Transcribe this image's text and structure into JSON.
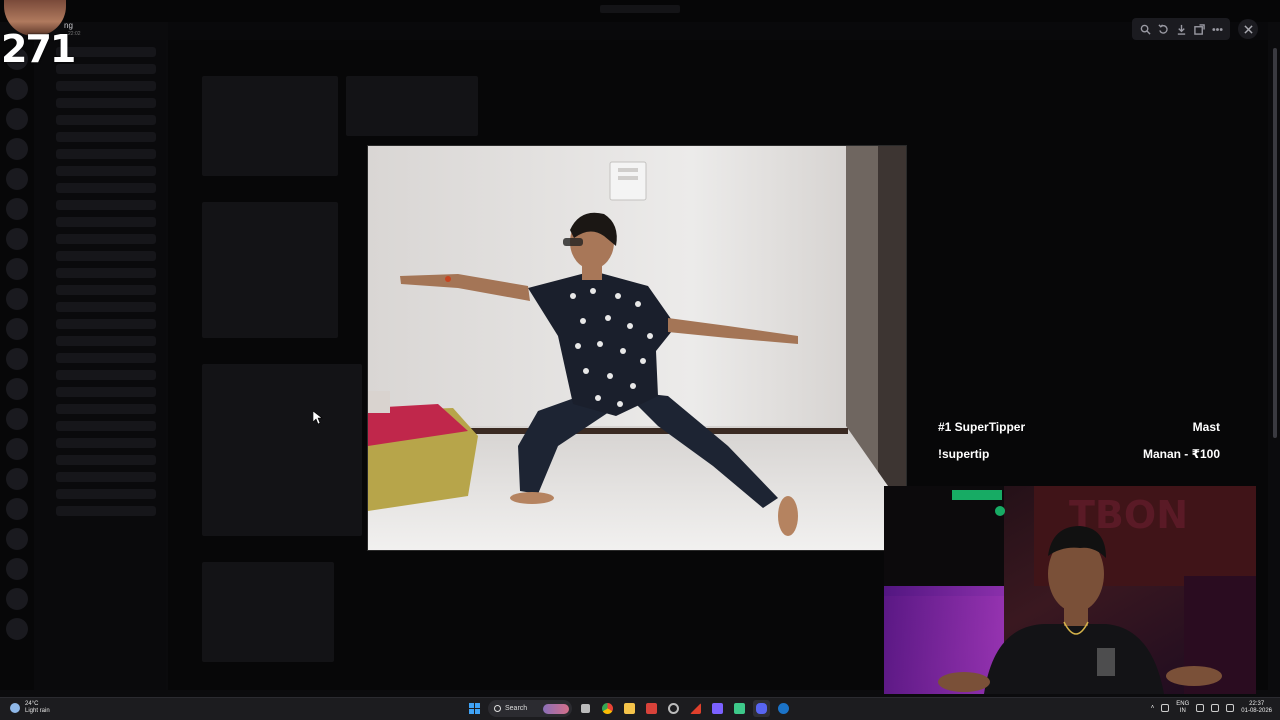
{
  "streamer_badge": {
    "count": "271",
    "name": "ng",
    "subtext": "22:02"
  },
  "viewer_toolbar": {
    "icons": [
      "zoom-icon",
      "rotate-icon",
      "download-icon",
      "open-external-icon",
      "more-icon"
    ],
    "close_icon": "close-icon"
  },
  "overlay": {
    "super_tipper": {
      "rank_label": "#1 SuperTipper",
      "rank_value": "Mast",
      "command_label": "!supertip",
      "command_value": "Manan - ₹100"
    }
  },
  "taskbar": {
    "weather": {
      "temp": "24°C",
      "condition": "Light rain"
    },
    "search_label": "Search",
    "apps": [
      "windows-start",
      "file-explorer",
      "chrome",
      "folder",
      "media",
      "app-red",
      "settings",
      "app-purple",
      "app-green",
      "discord",
      "steam"
    ],
    "tray": {
      "language_top": "ENG",
      "language_bottom": "IN",
      "time": "22:37",
      "date": "01-08-2026"
    }
  },
  "colors": {
    "background": "#000000",
    "overlay_text": "#ffffff",
    "taskbar": "#1c1c1f",
    "windows_blue": "#3fa2f5"
  }
}
